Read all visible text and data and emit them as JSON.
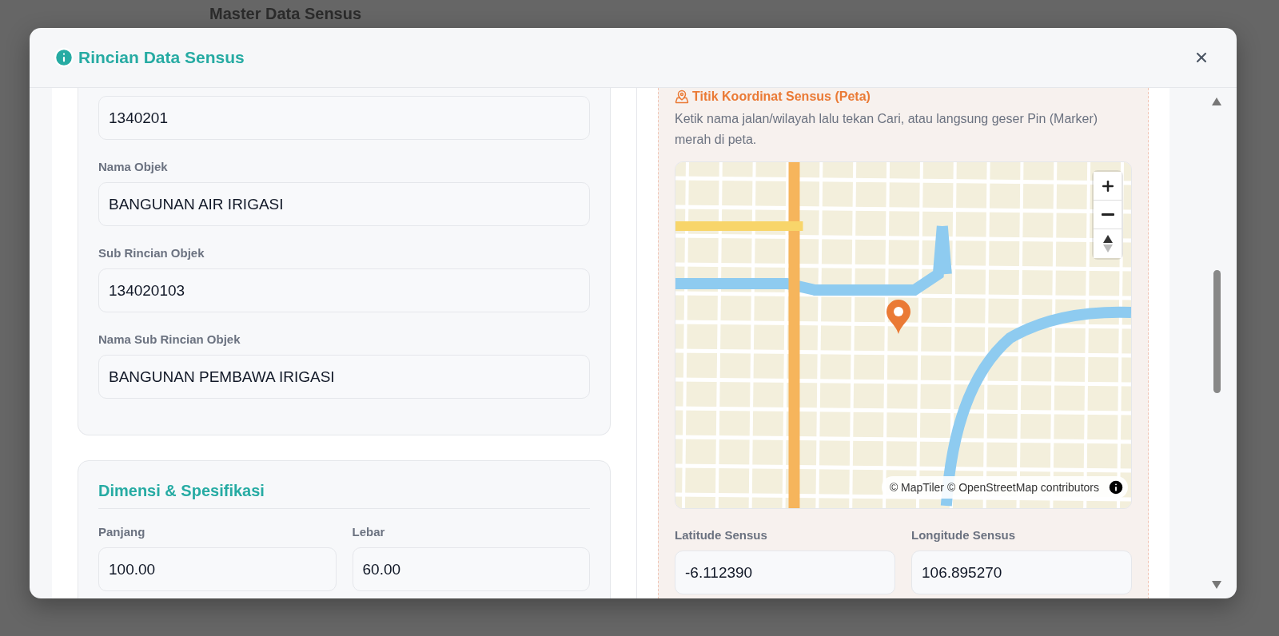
{
  "background": {
    "title": "Master Data Sensus"
  },
  "dialog": {
    "title": "Rincian Data Sensus"
  },
  "object_fields": [
    {
      "value": "1340201"
    },
    {
      "label": "Nama Objek",
      "value": "BANGUNAN AIR IRIGASI"
    },
    {
      "label": "Sub Rincian Objek",
      "value": "134020103"
    },
    {
      "label": "Nama Sub Rincian Objek",
      "value": "BANGUNAN PEMBAWA IRIGASI"
    }
  ],
  "dimensions": {
    "title": "Dimensi & Spesifikasi",
    "fields": [
      {
        "label": "Panjang",
        "value": "100.00"
      },
      {
        "label": "Lebar",
        "value": "60.00"
      }
    ]
  },
  "map_panel": {
    "title": "Titik Koordinat Sensus (Peta)",
    "hint": "Ketik nama jalan/wilayah lalu tekan Cari, atau langsung geser Pin (Marker) merah di peta.",
    "attribution": "© MapTiler © OpenStreetMap contributors",
    "fields": [
      {
        "label": "Latitude Sensus",
        "value": "-6.112390"
      },
      {
        "label": "Longitude Sensus",
        "value": "106.895270"
      }
    ]
  }
}
